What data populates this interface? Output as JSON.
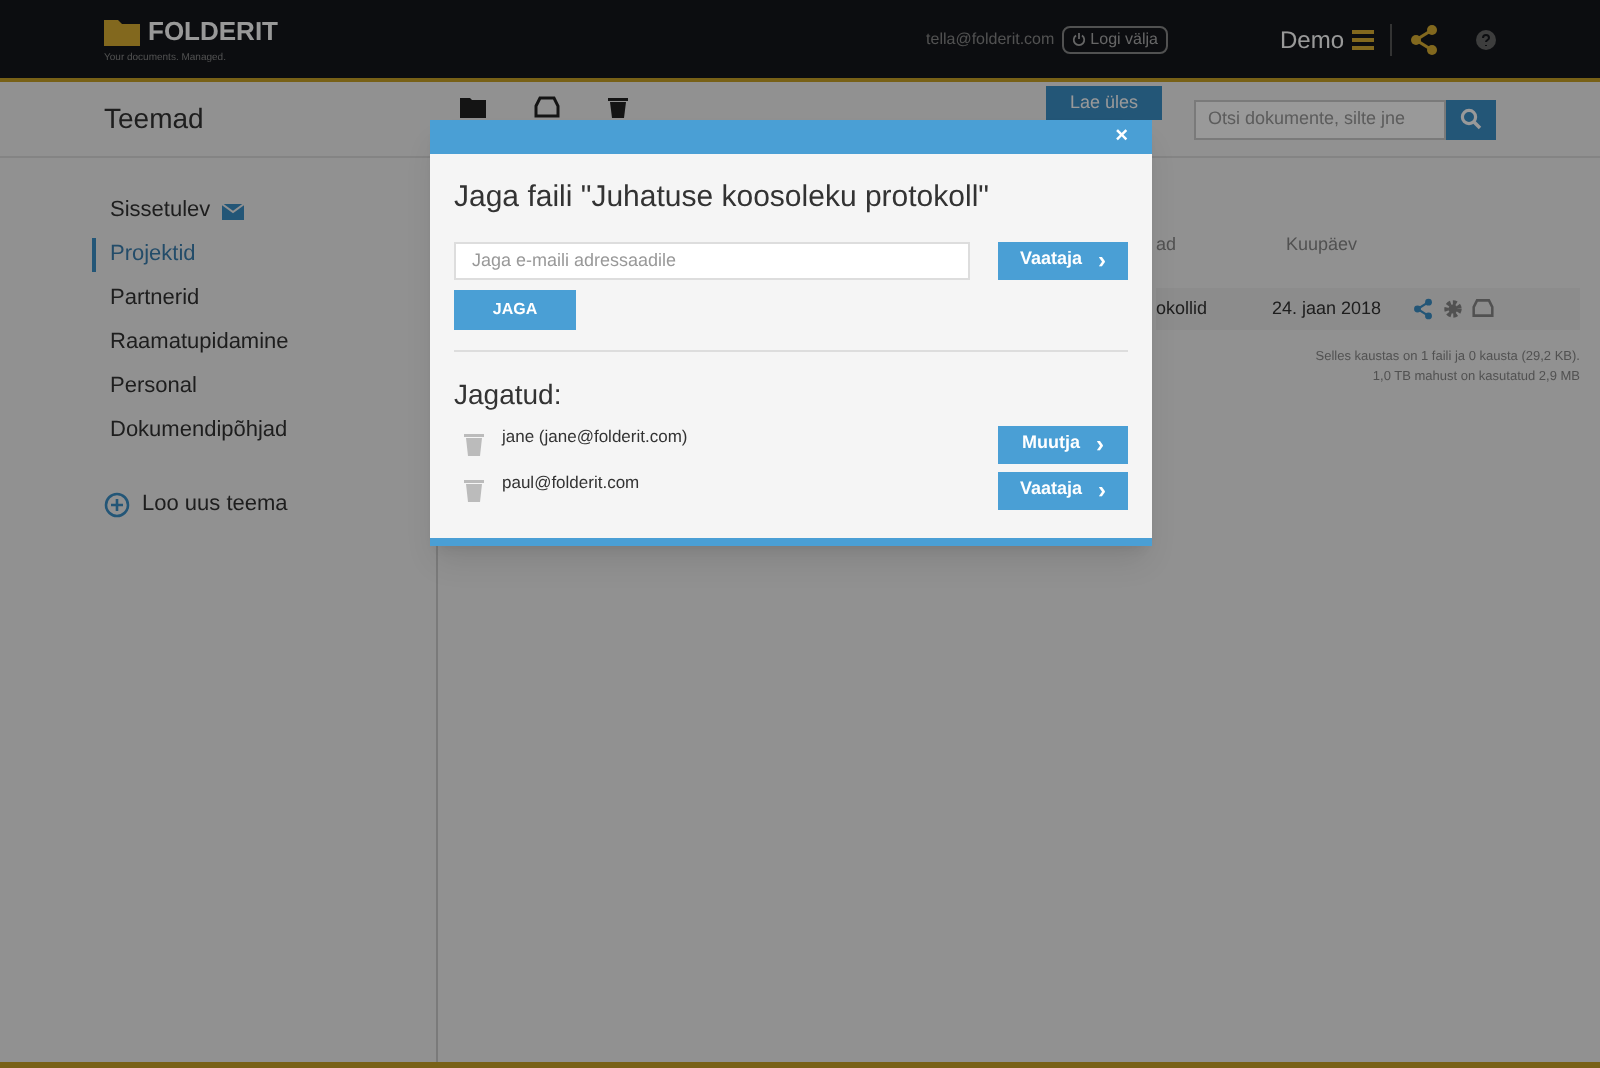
{
  "header": {
    "logo": "FOLDERIT",
    "tagline": "Your documents. Managed.",
    "email": "tella@folderit.com",
    "logout": "Logi välja",
    "account": "Demo"
  },
  "toolbar": {
    "title": "Teemad",
    "upload": "Lae üles",
    "search_placeholder": "Otsi dokumente, silte jne"
  },
  "sidebar": {
    "items": [
      {
        "label": "Sissetulev",
        "selected": false,
        "kind": "inbox"
      },
      {
        "label": "Projektid",
        "selected": true,
        "kind": "topic"
      },
      {
        "label": "Partnerid",
        "selected": false,
        "kind": "topic"
      },
      {
        "label": "Raamatupidamine",
        "selected": false,
        "kind": "topic"
      },
      {
        "label": "Personal",
        "selected": false,
        "kind": "topic"
      },
      {
        "label": "Dokumendipõhjad",
        "selected": false,
        "kind": "topic"
      }
    ],
    "new_topic": "Loo uus teema"
  },
  "table": {
    "columns": [
      "ad",
      "Kuupäev"
    ],
    "rows": [
      {
        "column_1": "okollid",
        "date": "24. jaan 2018"
      }
    ],
    "footer": [
      "Selles kaustas on 1 faili ja 0 kausta (29,2 KB).",
      "1,0 TB mahust on kasutatud 2,9 MB"
    ]
  },
  "dialog": {
    "close": "×",
    "title": "Jaga faili \"Juhatuse koosoleku protokoll\"",
    "email_placeholder": "Jaga e-maili adressaadile",
    "role": "Vaataja",
    "share": "JAGA",
    "shared_title": "Jagatud:",
    "shared": [
      {
        "user": "jane (jane@folderit.com)",
        "role": "Muutja"
      },
      {
        "user": "paul@folderit.com",
        "role": "Vaataja"
      }
    ],
    "chevron": "›"
  }
}
